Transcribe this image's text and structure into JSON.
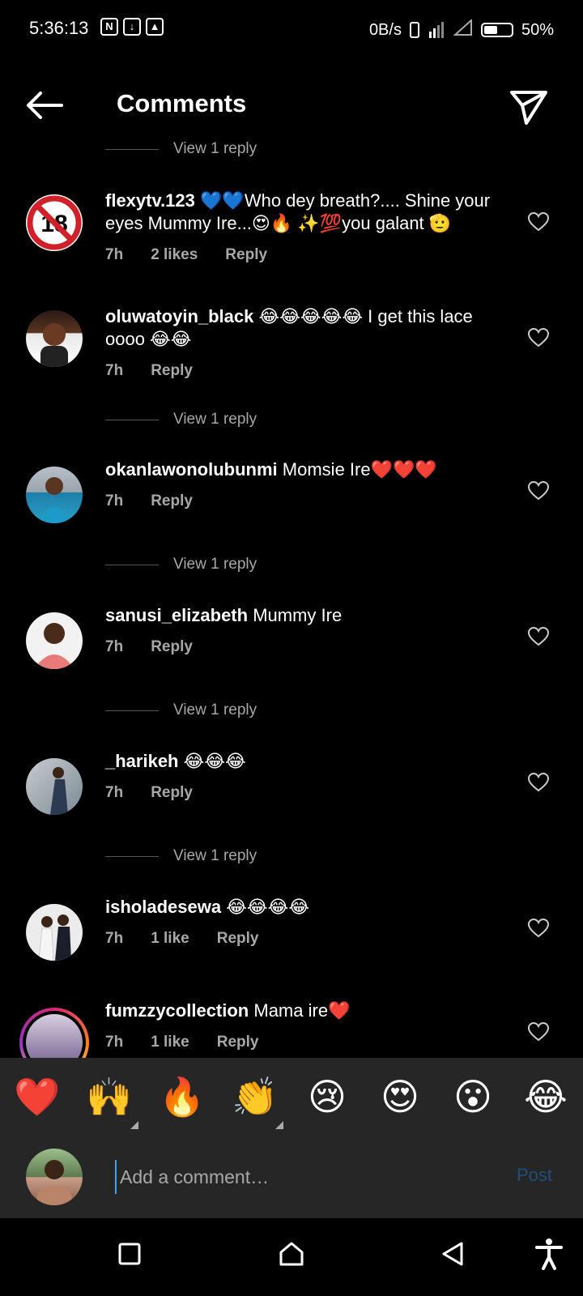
{
  "status_bar": {
    "time": "5:36:13",
    "net_speed": "0B/s",
    "battery": "50%"
  },
  "header": {
    "title": "Comments"
  },
  "comments": [
    {
      "username": "flexytv.123",
      "text": "💙💙Who dey breath?.... Shine your eyes Mummy Ire...😍🔥 ✨💯you galant 🫡",
      "time": "7h",
      "likes": "2 likes",
      "reply": "Reply"
    },
    {
      "username": "oluwatoyin_black",
      "text": "😂😂😂😂😂 I get this lace oooo 😂😂",
      "time": "7h",
      "reply": "Reply",
      "view_replies": "View 1 reply"
    },
    {
      "username": "okanlawonolubunmi",
      "text": "Momsie Ire❤️❤️❤️",
      "time": "7h",
      "reply": "Reply",
      "view_replies": "View 1 reply"
    },
    {
      "username": "sanusi_elizabeth",
      "text": "Mummy Ire",
      "time": "7h",
      "reply": "Reply",
      "view_replies": "View 1 reply"
    },
    {
      "username": "_harikeh",
      "text": "😂😂😂",
      "time": "7h",
      "reply": "Reply",
      "view_replies": "View 1 reply"
    },
    {
      "username": "isholadesewa",
      "text": "😂😂😂😂",
      "time": "7h",
      "likes": "1 like",
      "reply": "Reply"
    },
    {
      "username": "fumzzycollection",
      "text": "Mama ire❤️",
      "time": "7h",
      "likes": "1 like",
      "reply": "Reply"
    }
  ],
  "top_view_reply": "View 1 reply",
  "emoji_bar": [
    "❤️",
    "🙌",
    "🔥",
    "👏",
    "😢",
    "😍",
    "😮",
    "😂"
  ],
  "input": {
    "placeholder": "Add a comment…",
    "post_label": "Post"
  },
  "colors": {
    "background": "#000000",
    "panel": "#262626",
    "muted_text": "#a8a8a8",
    "post_disabled": "#1f4e78",
    "cursor": "#3aa4f0"
  }
}
